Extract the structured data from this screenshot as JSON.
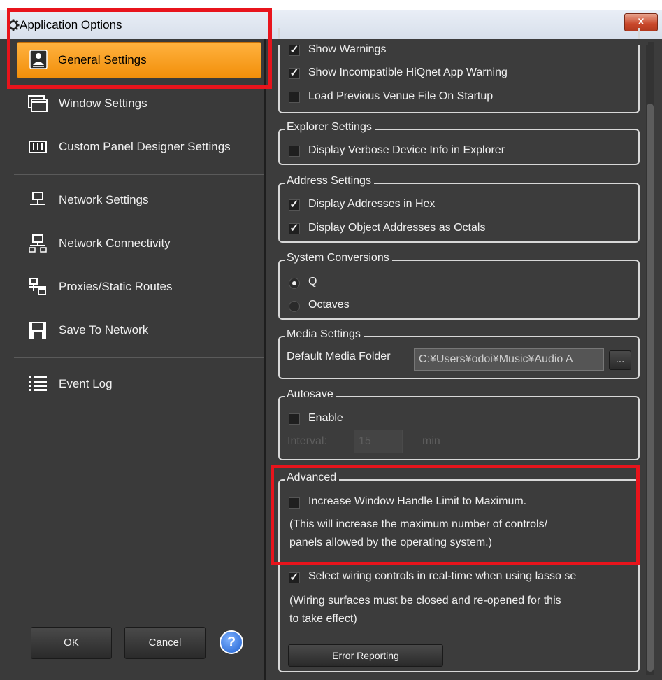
{
  "window": {
    "title": "Application Options",
    "close_label": "x"
  },
  "sidebar": {
    "items": [
      {
        "label": "General Settings",
        "icon": "general-settings-icon",
        "selected": true
      },
      {
        "label": "Window Settings",
        "icon": "window-icon"
      },
      {
        "label": "Custom Panel Designer Settings",
        "icon": "panel-designer-icon"
      },
      {
        "label": "Network Settings",
        "icon": "network-icon"
      },
      {
        "label": "Network Connectivity",
        "icon": "network-connectivity-icon"
      },
      {
        "label": "Proxies/Static Routes",
        "icon": "proxies-icon"
      },
      {
        "label": "Save To Network",
        "icon": "save-to-network-icon"
      },
      {
        "label": "Event Log",
        "icon": "event-log-icon"
      }
    ],
    "ok_label": "OK",
    "cancel_label": "Cancel",
    "help_label": "?"
  },
  "general": {
    "options": [
      {
        "label": "Show Warnings",
        "checked": true
      },
      {
        "label": "Show Incompatible HiQnet App Warning",
        "checked": true
      },
      {
        "label": "Load Previous Venue File On Startup",
        "checked": false
      }
    ]
  },
  "explorer": {
    "title": "Explorer Settings",
    "options": [
      {
        "label": "Display Verbose Device Info in Explorer",
        "checked": false
      }
    ]
  },
  "address": {
    "title": "Address Settings",
    "options": [
      {
        "label": "Display Addresses in Hex",
        "checked": true
      },
      {
        "label": "Display Object Addresses as Octals",
        "checked": true
      }
    ]
  },
  "conversions": {
    "title": "System Conversions",
    "options": [
      {
        "label": "Q",
        "selected": true
      },
      {
        "label": "Octaves",
        "selected": false
      }
    ]
  },
  "media": {
    "title": "Media Settings",
    "folder_label": "Default Media Folder",
    "folder_value": "C:¥Users¥odoi¥Music¥Audio A",
    "browse_label": "..."
  },
  "autosave": {
    "title": "Autosave",
    "enable_label": "Enable",
    "enabled": false,
    "interval_label": "Interval:",
    "interval_value": "15",
    "interval_unit": "min"
  },
  "advanced": {
    "title": "Advanced",
    "window_handle_label": "Increase Window Handle Limit to Maximum.",
    "window_handle_checked": false,
    "window_handle_note_1": "(This will increase the maximum number of controls/",
    "window_handle_note_2": "panels allowed by the operating system.)",
    "lasso_label": "Select wiring controls in real-time when using lasso se",
    "lasso_checked": true,
    "lasso_note_1": "(Wiring surfaces must be closed and re-opened for this",
    "lasso_note_2": "to take effect)",
    "error_reporting_label": "Error Reporting"
  },
  "colors": {
    "selected_nav": "#f5a020",
    "highlight_box": "#e8141c",
    "panel_background": "#3c3c3c"
  }
}
